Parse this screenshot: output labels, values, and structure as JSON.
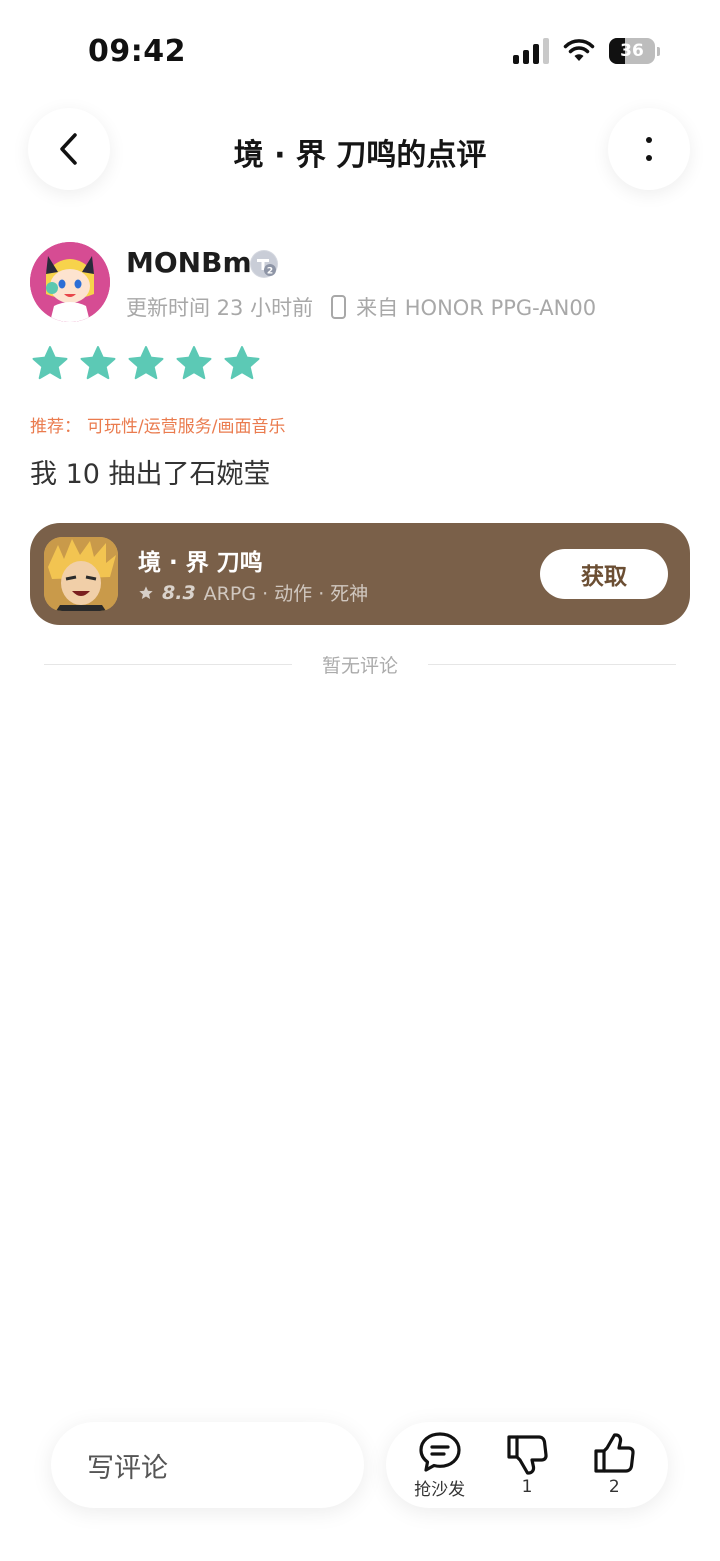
{
  "status_bar": {
    "time": "09:42",
    "battery": "36"
  },
  "header": {
    "title": "境 · 界 刀鸣的点评"
  },
  "author": {
    "username": "MONBm",
    "level": "2",
    "updated": "更新时间 23 小时前",
    "device": "来自 HONOR PPG-AN00"
  },
  "review": {
    "stars": 5,
    "recommend_label": "推荐：",
    "recommend_tags": "可玩性/运营服务/画面音乐",
    "text": "我 10 抽出了石婉莹"
  },
  "game": {
    "name": "境 · 界 刀鸣",
    "rating": "8.3",
    "tags": "ARPG · 动作 · 死神",
    "get_label": "获取"
  },
  "comments": {
    "empty_text": "暂无评论"
  },
  "bottom_bar": {
    "write_placeholder": "写评论",
    "sofa_label": "抢沙发",
    "dislike_count": "1",
    "like_count": "2"
  },
  "colors": {
    "star": "#5cc9b5",
    "recommend": "#ea7b4e",
    "card_bg": "#7a6049",
    "avatar_bg": "#d64c93"
  }
}
